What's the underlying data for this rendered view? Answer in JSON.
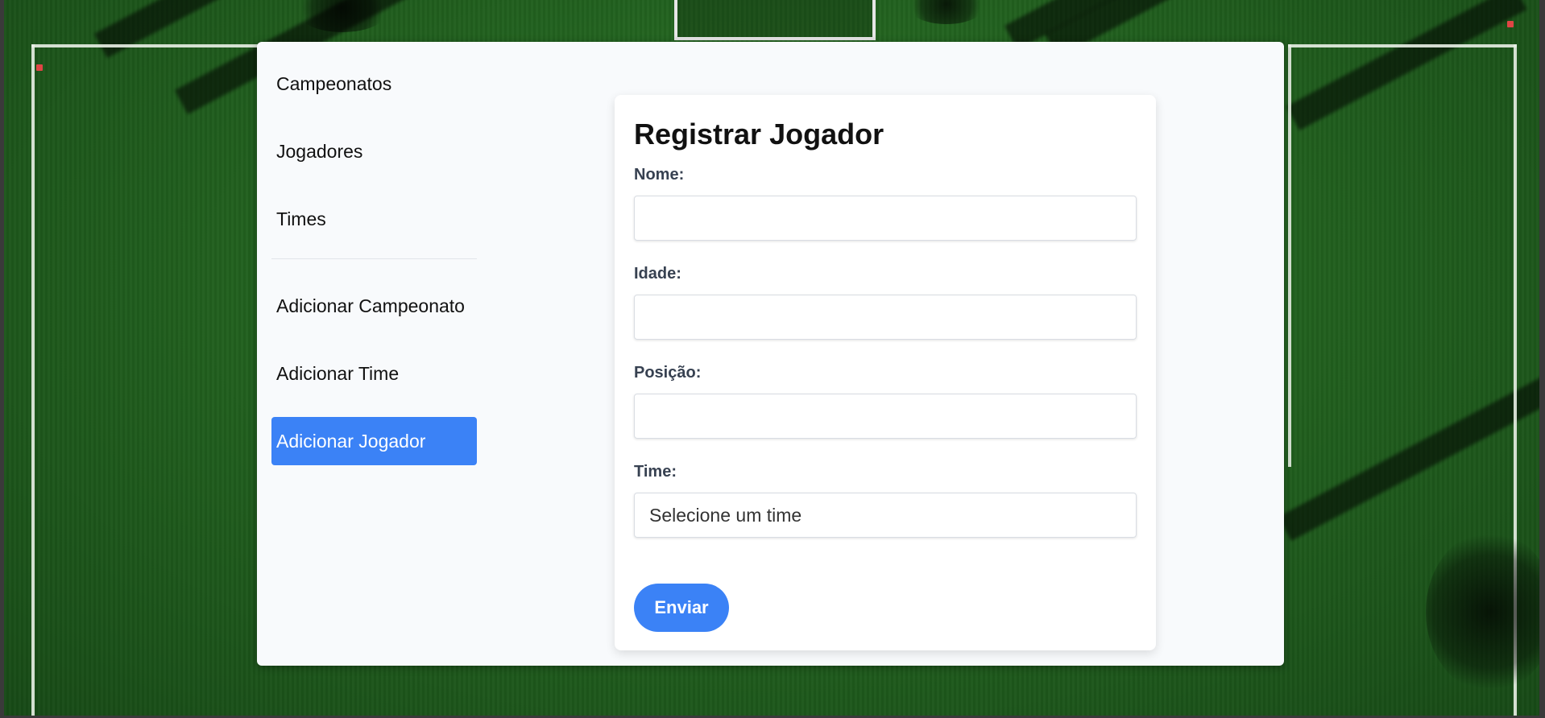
{
  "sidebar": {
    "items": [
      {
        "label": "Campeonatos"
      },
      {
        "label": "Jogadores"
      },
      {
        "label": "Times"
      },
      {
        "label": "Adicionar Campeonato"
      },
      {
        "label": "Adicionar Time"
      },
      {
        "label": "Adicionar Jogador",
        "active": true
      }
    ]
  },
  "form": {
    "title": "Registrar Jogador",
    "fields": {
      "nome": {
        "label": "Nome:",
        "value": ""
      },
      "idade": {
        "label": "Idade:",
        "value": ""
      },
      "posicao": {
        "label": "Posição:",
        "value": ""
      },
      "time": {
        "label": "Time:",
        "selected": "Selecione um time"
      }
    },
    "submit_label": "Enviar"
  },
  "colors": {
    "accent": "#3b82f6",
    "panel_bg": "#f8fafc",
    "card_bg": "#ffffff",
    "label_text": "#374151"
  }
}
